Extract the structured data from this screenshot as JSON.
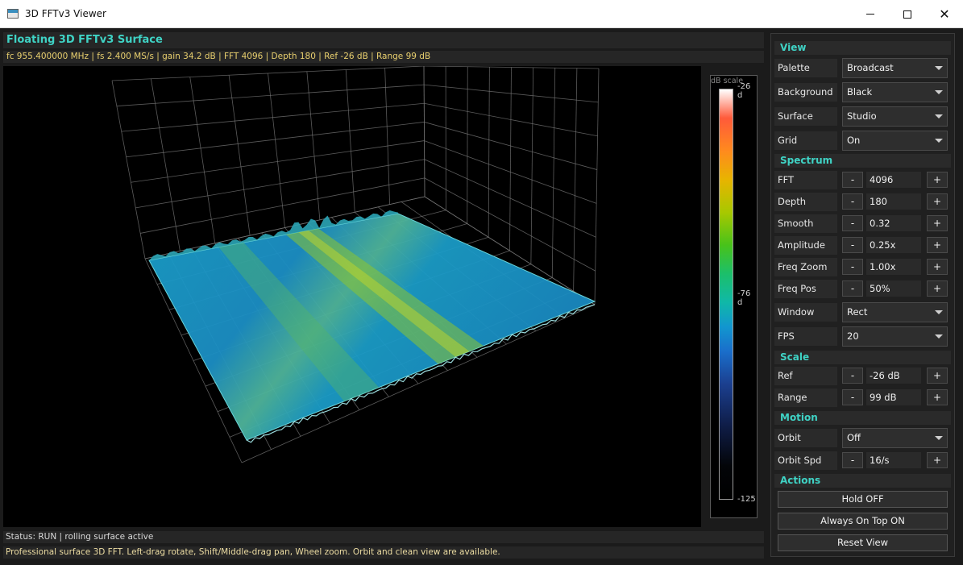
{
  "window": {
    "title": "3D FFTv3 Viewer",
    "controls": [
      "minimize-icon",
      "maximize-icon",
      "close-icon"
    ]
  },
  "heading": "Floating 3D FFTv3 Surface",
  "infobar": "fc 955.400000 MHz | fs 2.400 MS/s | gain 34.2 dB | FFT 4096 | Depth 180 | Ref -26 dB | Range 99 dB",
  "colorbar": {
    "title": "dB scale",
    "top_label": "-26 d",
    "mid_label": "-76 d",
    "bottom_label": "-125"
  },
  "status": "Status: RUN | rolling surface active",
  "help": "Professional surface 3D FFT. Left-drag rotate, Shift/Middle-drag pan, Wheel zoom. Orbit and clean view are available.",
  "panel": {
    "view": {
      "title": "View",
      "palette": {
        "label": "Palette",
        "value": "Broadcast"
      },
      "background": {
        "label": "Background",
        "value": "Black"
      },
      "surface": {
        "label": "Surface",
        "value": "Studio"
      },
      "grid": {
        "label": "Grid",
        "value": "On"
      }
    },
    "spectrum": {
      "title": "Spectrum",
      "fft": {
        "label": "FFT",
        "value": "4096"
      },
      "depth": {
        "label": "Depth",
        "value": "180"
      },
      "smooth": {
        "label": "Smooth",
        "value": "0.32"
      },
      "amplitude": {
        "label": "Amplitude",
        "value": "0.25x"
      },
      "freq_zoom": {
        "label": "Freq Zoom",
        "value": "1.00x"
      },
      "freq_pos": {
        "label": "Freq Pos",
        "value": "50%"
      },
      "window": {
        "label": "Window",
        "value": "Rect"
      },
      "fps": {
        "label": "FPS",
        "value": "20"
      }
    },
    "scale": {
      "title": "Scale",
      "ref": {
        "label": "Ref",
        "value": "-26 dB"
      },
      "range": {
        "label": "Range",
        "value": "99 dB"
      }
    },
    "motion": {
      "title": "Motion",
      "orbit": {
        "label": "Orbit",
        "value": "Off"
      },
      "orbit_spd": {
        "label": "Orbit Spd",
        "value": "16/s"
      }
    },
    "actions": {
      "title": "Actions",
      "hold": "Hold OFF",
      "always_on_top": "Always On Top ON",
      "reset_view": "Reset View"
    },
    "minus": "-",
    "plus": "+"
  }
}
